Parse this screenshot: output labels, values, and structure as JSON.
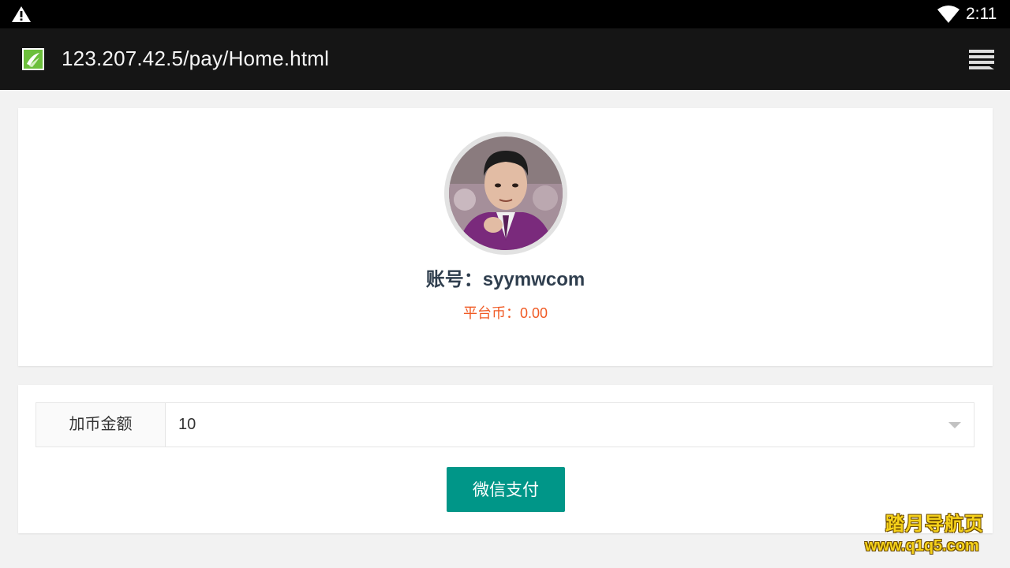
{
  "status_bar": {
    "time": "2:11",
    "left_icon": "warning-icon",
    "right_icons": [
      "wifi-icon"
    ]
  },
  "browser": {
    "url": "123.207.42.5/pay/Home.html",
    "site_icon": "site-favicon-icon",
    "menu_icon": "tabs-menu-icon"
  },
  "profile": {
    "account_label": "账号：",
    "account_name": "syymwcom",
    "coins_label": "平台币：",
    "coins_value": "0.00"
  },
  "payment": {
    "amount_label": "加币金额",
    "amount_selected": "10",
    "pay_button_label": "微信支付"
  },
  "watermark": {
    "title": "踏月导航页",
    "url": "www.q1q5.com"
  },
  "colors": {
    "accent": "#009688",
    "coins_text": "#f05a24",
    "account_text": "#2f3e4e"
  }
}
